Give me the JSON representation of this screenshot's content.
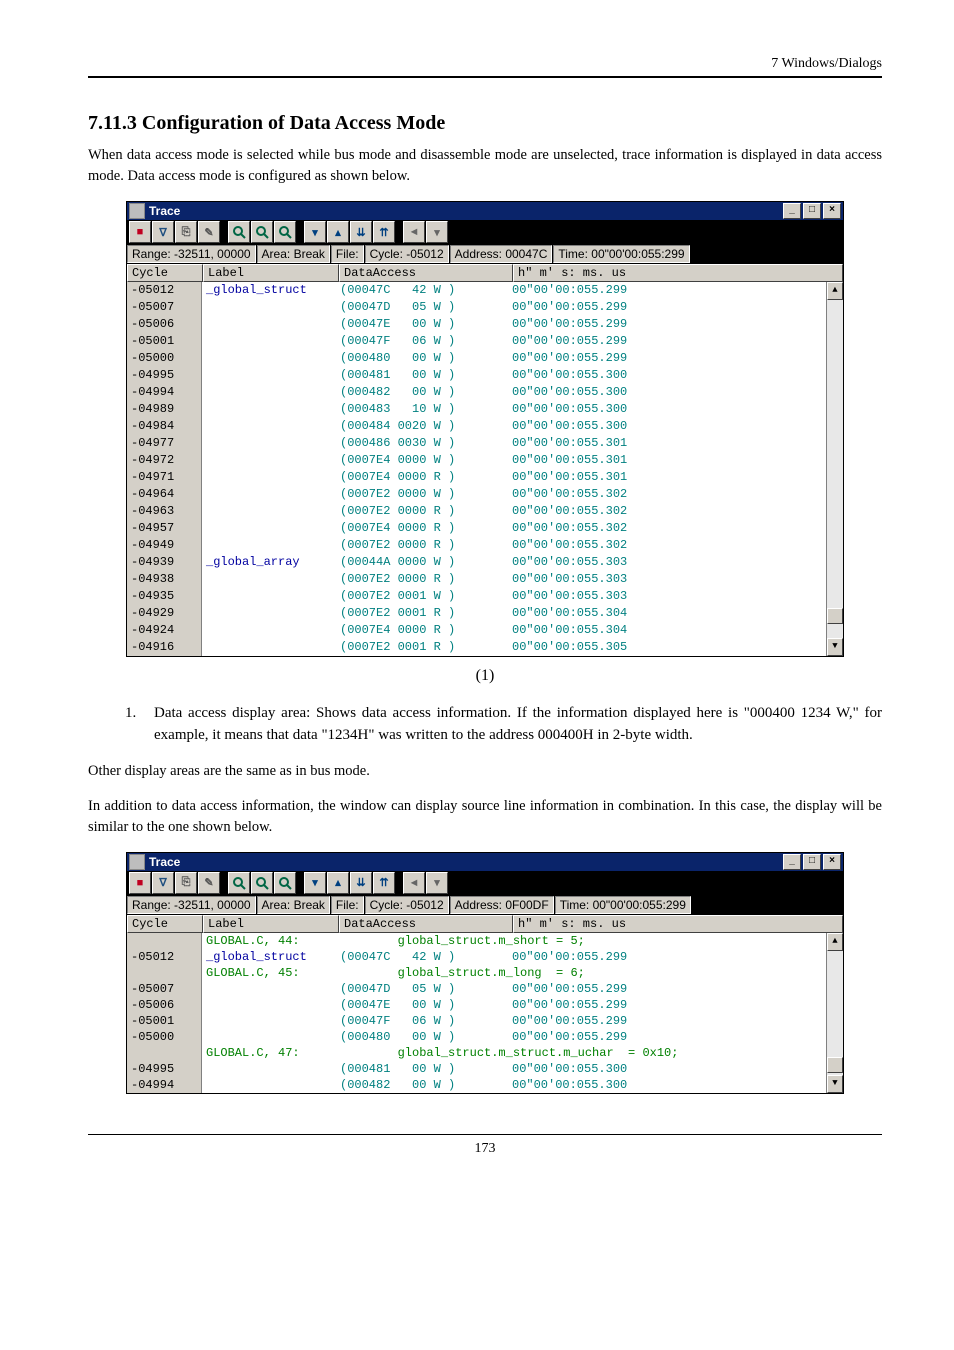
{
  "page": {
    "header_right": "7  Windows/Dialogs",
    "section_title": "7.11.3 Configuration of Data Access Mode",
    "intro": "When data access mode is selected while bus mode and disassemble mode are unselected, trace information is displayed in data access mode. Data access mode is configured as shown below.",
    "fig1_caption": "(1)",
    "list_item_1": "Data access display area: Shows data access information. If the information displayed here is \"000400 1234 W,\" for example, it means that data \"1234H\" was written to the address 000400H in 2-byte width.",
    "para2": "Other display areas are the same as in bus mode.",
    "para3": "In addition to data access information, the window can display source line information in combination. In this case, the display will be similar to the one shown below.",
    "footer": "173"
  },
  "trace1": {
    "title": "Trace",
    "status": {
      "range": "Range: -32511, 00000",
      "area": "Area: Break",
      "file": "File:",
      "cycle": "Cycle: -05012",
      "addr": "Address: 00047C",
      "time": "Time: 00\"00'00:055:299"
    },
    "cols": {
      "cycle": "Cycle",
      "label": "Label",
      "da": "DataAccess",
      "time": "  h\" m' s: ms. us "
    },
    "rows": [
      {
        "c": "-05012",
        "l": "_global_struct",
        "d": "(00047C   42 W )",
        "t": "00\"00'00:055.299"
      },
      {
        "c": "-05007",
        "l": "",
        "d": "(00047D   05 W )",
        "t": "00\"00'00:055.299"
      },
      {
        "c": "-05006",
        "l": "",
        "d": "(00047E   00 W )",
        "t": "00\"00'00:055.299"
      },
      {
        "c": "-05001",
        "l": "",
        "d": "(00047F   06 W )",
        "t": "00\"00'00:055.299"
      },
      {
        "c": "-05000",
        "l": "",
        "d": "(000480   00 W )",
        "t": "00\"00'00:055.299"
      },
      {
        "c": "-04995",
        "l": "",
        "d": "(000481   00 W )",
        "t": "00\"00'00:055.300"
      },
      {
        "c": "-04994",
        "l": "",
        "d": "(000482   00 W )",
        "t": "00\"00'00:055.300"
      },
      {
        "c": "-04989",
        "l": "",
        "d": "(000483   10 W )",
        "t": "00\"00'00:055.300"
      },
      {
        "c": "-04984",
        "l": "",
        "d": "(000484 0020 W )",
        "t": "00\"00'00:055.300"
      },
      {
        "c": "-04977",
        "l": "",
        "d": "(000486 0030 W )",
        "t": "00\"00'00:055.301"
      },
      {
        "c": "-04972",
        "l": "",
        "d": "(0007E4 0000 W )",
        "t": "00\"00'00:055.301"
      },
      {
        "c": "-04971",
        "l": "",
        "d": "(0007E4 0000 R )",
        "t": "00\"00'00:055.301"
      },
      {
        "c": "-04964",
        "l": "",
        "d": "(0007E2 0000 W )",
        "t": "00\"00'00:055.302"
      },
      {
        "c": "-04963",
        "l": "",
        "d": "(0007E2 0000 R )",
        "t": "00\"00'00:055.302"
      },
      {
        "c": "-04957",
        "l": "",
        "d": "(0007E4 0000 R )",
        "t": "00\"00'00:055.302"
      },
      {
        "c": "-04949",
        "l": "",
        "d": "(0007E2 0000 R )",
        "t": "00\"00'00:055.302"
      },
      {
        "c": "-04939",
        "l": "_global_array",
        "d": "(00044A 0000 W )",
        "t": "00\"00'00:055.303"
      },
      {
        "c": "-04938",
        "l": "",
        "d": "(0007E2 0000 R )",
        "t": "00\"00'00:055.303"
      },
      {
        "c": "-04935",
        "l": "",
        "d": "(0007E2 0001 W )",
        "t": "00\"00'00:055.303"
      },
      {
        "c": "-04929",
        "l": "",
        "d": "(0007E2 0001 R )",
        "t": "00\"00'00:055.304"
      },
      {
        "c": "-04924",
        "l": "",
        "d": "(0007E4 0000 R )",
        "t": "00\"00'00:055.304"
      },
      {
        "c": "-04916",
        "l": "",
        "d": "(0007E2 0001 R )",
        "t": "00\"00'00:055.305"
      }
    ]
  },
  "trace2": {
    "title": "Trace",
    "status": {
      "range": "Range: -32511, 00000",
      "area": "Area: Break",
      "file": "File:",
      "cycle": "Cycle: -05012",
      "addr": "Address: 0F00DF",
      "time": "Time: 00\"00'00:055:299"
    },
    "cols": {
      "cycle": "Cycle",
      "label": "Label",
      "da": "DataAccess",
      "time": "  h\" m' s: ms. us "
    },
    "rows": [
      {
        "c": "",
        "l": "GLOBAL.C, 44:",
        "d": "",
        "src": "global_struct.m_short = 5;",
        "t": ""
      },
      {
        "c": "-05012",
        "l": "_global_struct",
        "d": "(00047C   42 W )",
        "t": "00\"00'00:055.299"
      },
      {
        "c": "",
        "l": "GLOBAL.C, 45:",
        "d": "",
        "src": "global_struct.m_long  = 6;",
        "t": ""
      },
      {
        "c": "-05007",
        "l": "",
        "d": "(00047D   05 W )",
        "t": "00\"00'00:055.299"
      },
      {
        "c": "-05006",
        "l": "",
        "d": "(00047E   00 W )",
        "t": "00\"00'00:055.299"
      },
      {
        "c": "-05001",
        "l": "",
        "d": "(00047F   06 W )",
        "t": "00\"00'00:055.299"
      },
      {
        "c": "-05000",
        "l": "",
        "d": "(000480   00 W )",
        "t": "00\"00'00:055.299"
      },
      {
        "c": "",
        "l": "GLOBAL.C, 47:",
        "d": "",
        "src": "global_struct.m_struct.m_uchar  = 0x10;",
        "t": ""
      },
      {
        "c": "-04995",
        "l": "",
        "d": "(000481   00 W )",
        "t": "00\"00'00:055.300"
      },
      {
        "c": "-04994",
        "l": "",
        "d": "(000482   00 W )",
        "t": "00\"00'00:055.300"
      }
    ]
  }
}
